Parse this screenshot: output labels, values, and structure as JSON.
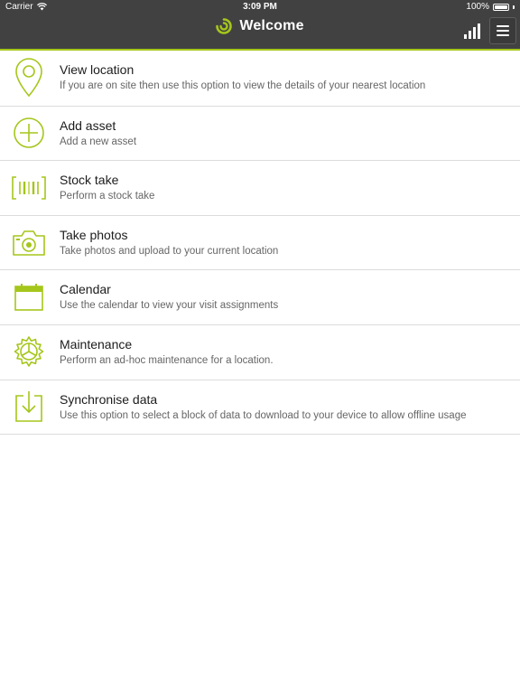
{
  "status_bar": {
    "carrier": "Carrier",
    "time": "3:09 PM",
    "battery": "100%",
    "battery_level": 1.0
  },
  "nav": {
    "title": "Welcome",
    "brand_color": "#a5c61b",
    "bar_color": "#414141"
  },
  "menu_items": [
    {
      "title": "View location",
      "subtitle": "If you are on site then use this option to view the details of your nearest location",
      "icon": "location-pin-icon"
    },
    {
      "title": "Add asset",
      "subtitle": "Add a new asset",
      "icon": "add-circle-icon"
    },
    {
      "title": "Stock take",
      "subtitle": "Perform a stock take",
      "icon": "barcode-icon"
    },
    {
      "title": "Take photos",
      "subtitle": "Take photos and upload to your current location",
      "icon": "camera-icon"
    },
    {
      "title": "Calendar",
      "subtitle": "Use the calendar to view your visit assignments",
      "icon": "calendar-icon"
    },
    {
      "title": "Maintenance",
      "subtitle": "Perform an ad-hoc maintenance for a location.",
      "icon": "gear-icon"
    },
    {
      "title": "Synchronise data",
      "subtitle": "Use this option to select a block of data to download to your device to allow offline usage",
      "icon": "download-icon"
    }
  ]
}
